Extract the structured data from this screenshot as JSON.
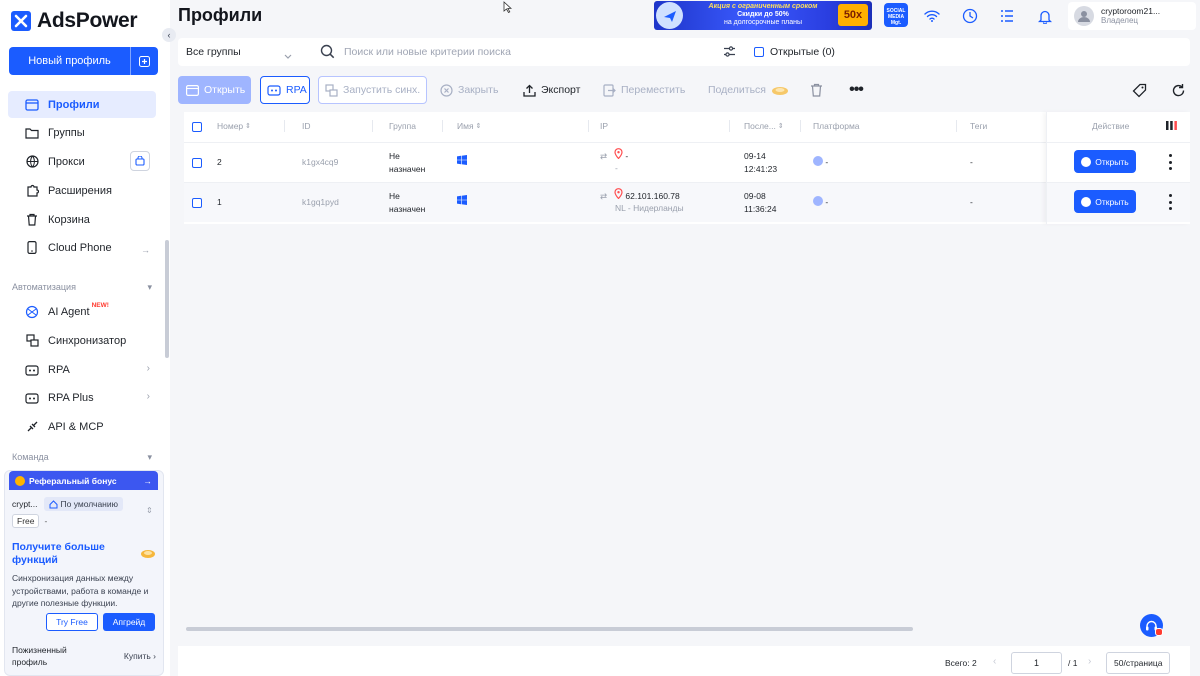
{
  "app": {
    "name": "AdsPower"
  },
  "page": {
    "title": "Профили"
  },
  "sidebar": {
    "new_profile_label": "Новый профиль",
    "items": [
      {
        "label": "Профили",
        "icon": "profiles-icon"
      },
      {
        "label": "Группы",
        "icon": "folder-icon"
      },
      {
        "label": "Прокси",
        "icon": "globe-icon"
      },
      {
        "label": "Расширения",
        "icon": "puzzle-icon"
      },
      {
        "label": "Корзина",
        "icon": "trash-icon"
      },
      {
        "label": "Cloud Phone",
        "icon": "phone-icon"
      }
    ],
    "automation_label": "Автоматизация",
    "automation_items": [
      {
        "label": "AI Agent",
        "badge": "NEW!",
        "icon": "ai-agent-icon"
      },
      {
        "label": "Синхронизатор",
        "icon": "sync-icon"
      },
      {
        "label": "RPA",
        "icon": "rpa-icon"
      },
      {
        "label": "RPA Plus",
        "icon": "rpa-plus-icon"
      },
      {
        "label": "API & MCP",
        "icon": "api-icon"
      }
    ],
    "team_label": "Команда"
  },
  "promo": {
    "referral_label": "Реферальный бонус",
    "account_name": "crypt...",
    "default_label": "По умолчанию",
    "plan_label": "Free",
    "plan_extra": "-",
    "title": "Получите больше функций",
    "description": "Синхронизация данных между устройствами, работа в команде и другие полезные функции.",
    "try_free_label": "Try Free",
    "upgrade_label": "Апгрейд",
    "lifetime_label": "Пожизненный профиль",
    "buy_label": "Купить"
  },
  "banner": {
    "line1": "Акция с ограниченным сроком",
    "line2": "Скидки до 50%",
    "line3": "на долгосрочные планы",
    "badge": "50x"
  },
  "topbar": {
    "social_label": "SOCIAL MEDIA Mgt.",
    "user_name": "cryptoroom21...",
    "user_role": "Владелец"
  },
  "filters": {
    "group_select": "Все группы",
    "search_placeholder": "Поиск или новые критерии поиска",
    "open_filter_label": "Открытые (0)"
  },
  "toolbar": {
    "open_label": "Открыть",
    "rpa_label": "RPA",
    "sync_label": "Запустить синх.",
    "close_label": "Закрыть",
    "export_label": "Экспорт",
    "move_label": "Переместить",
    "share_label": "Поделиться"
  },
  "table": {
    "headers": {
      "number": "Номер",
      "id": "ID",
      "group": "Группа",
      "name": "Имя",
      "ip": "IP",
      "last": "После...",
      "platform": "Платформа",
      "tags": "Теги",
      "action": "Действие"
    },
    "rows": [
      {
        "number": "2",
        "id": "k1gx4cq9",
        "group_line1": "Не",
        "group_line2": "назначен",
        "ip": "-",
        "ip_sub": "-",
        "date": "09-14",
        "time": "12:41:23",
        "platform": "-",
        "tags": "-",
        "action": "Открыть"
      },
      {
        "number": "1",
        "id": "k1gq1pyd",
        "group_line1": "Не",
        "group_line2": "назначен",
        "ip": "62.101.160.78",
        "ip_sub": "NL - Нидерланды",
        "date": "09-08",
        "time": "11:36:24",
        "platform": "-",
        "tags": "-",
        "action": "Открыть"
      }
    ]
  },
  "footer": {
    "total": "Всего: 2",
    "page": "1",
    "page_total": "/ 1",
    "page_size": "50/страница"
  },
  "colors": {
    "accent": "#1b5cff",
    "page_bg": "#f5f6f9"
  }
}
